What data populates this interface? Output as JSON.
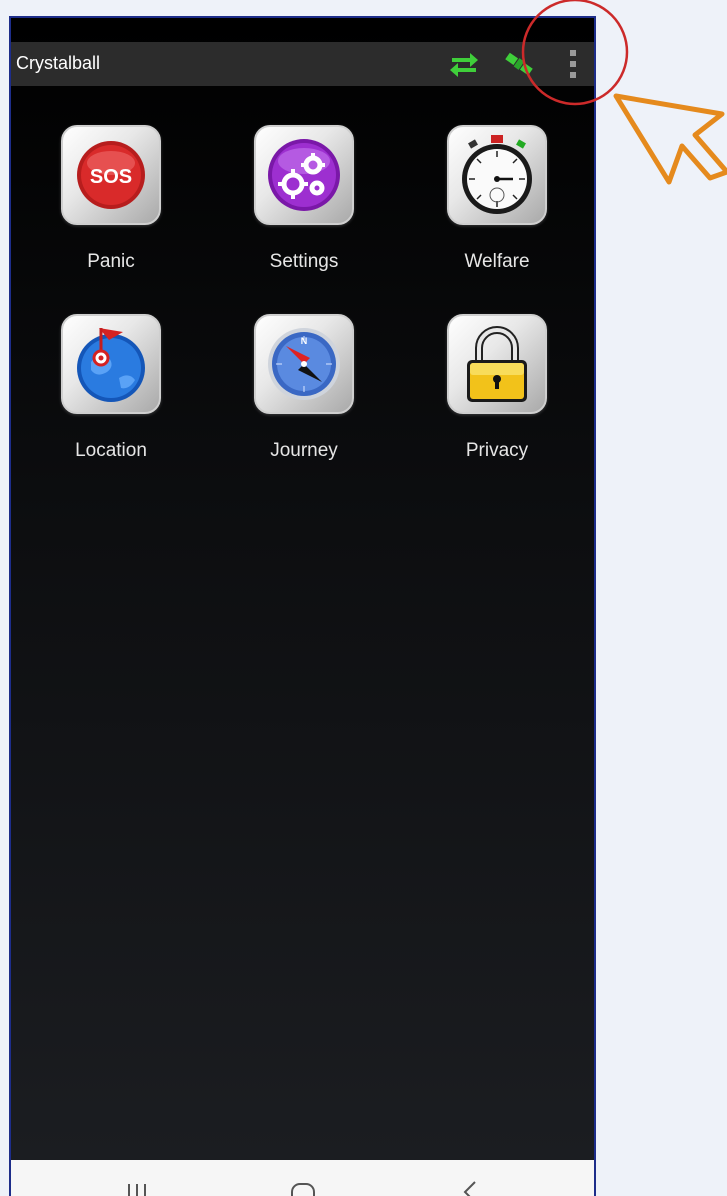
{
  "app": {
    "title": "Crystalball"
  },
  "toolbar": {
    "icons": [
      "sync-arrows-icon",
      "satellite-icon",
      "overflow-menu-icon"
    ],
    "accent_color": "#3fcf3a"
  },
  "tiles": [
    {
      "label": "Panic",
      "icon": "sos-icon",
      "icon_text": "SOS"
    },
    {
      "label": "Settings",
      "icon": "gears-icon"
    },
    {
      "label": "Welfare",
      "icon": "stopwatch-icon"
    },
    {
      "label": "Location",
      "icon": "globe-pin-icon"
    },
    {
      "label": "Journey",
      "icon": "compass-icon",
      "icon_text": "N"
    },
    {
      "label": "Privacy",
      "icon": "padlock-icon"
    }
  ],
  "system_nav": [
    "recent-apps-icon",
    "home-icon",
    "back-icon"
  ],
  "annotation": {
    "circle_color": "#cc2a2a",
    "arrow_color": "#e58a1d"
  }
}
